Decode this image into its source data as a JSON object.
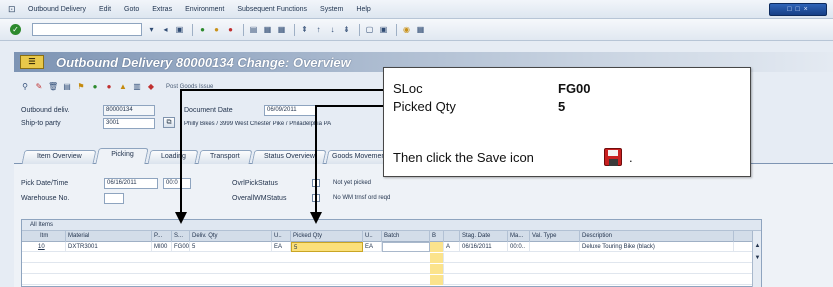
{
  "menu": {
    "items": [
      "Outbound Delivery",
      "Edit",
      "Goto",
      "Extras",
      "Environment",
      "Subsequent Functions",
      "System",
      "Help"
    ]
  },
  "window_controls": {
    "label": "□ □ ×"
  },
  "toolbar": {
    "command_value": ""
  },
  "page": {
    "title": "Outbound Delivery 80000134 Change: Overview",
    "app_icon_label": "☰",
    "post_goods_issue_label": "Post Goods Issue"
  },
  "header": {
    "outbound_delivery_label": "Outbound deliv.",
    "outbound_delivery_value": "80000134",
    "ship_to_label": "Ship-to party",
    "ship_to_value": "3001",
    "document_date_label": "Document Date",
    "document_date_value": "06/09/2011",
    "ship_to_address": "Philly Bikes / 3999 West Chester Pike / Philadelphia PA"
  },
  "tabs": [
    "Item Overview",
    "Picking",
    "Loading",
    "Transport",
    "Status Overview",
    "Goods Movement"
  ],
  "picking": {
    "pick_date_label": "Pick Date/Time",
    "pick_date_value": "06/16/2011",
    "pick_time_value": "00:0",
    "warehouse_label": "Warehouse No.",
    "warehouse_value": "",
    "ovrl_pick_status_label": "OvrlPickStatus",
    "ovrl_pick_status_text": "Not yet picked",
    "overall_wm_status_label": "OverallWMStatus",
    "overall_wm_status_text": "No WM trnsf ord reqd"
  },
  "table": {
    "title": "All Items",
    "columns": [
      "Itm",
      "Material",
      "P...",
      "S...",
      "Deliv. Qty",
      "U..",
      "Picked Qty",
      "U..",
      "Batch",
      "B",
      "",
      "Stag. Date",
      "Ma...",
      "Val. Type",
      "Description"
    ],
    "rows": [
      {
        "item": "10",
        "material": "DXTR3001",
        "plant": "MI00",
        "sloc": "FG00",
        "deliv_qty": "5",
        "deliv_unit": "EA",
        "picked_qty": "5",
        "picked_unit": "EA",
        "batch": "",
        "b": "",
        "a": "A",
        "stag_date": "06/16/2011",
        "ma": "00:0..",
        "val_type": "",
        "description": "Deluxe Touring Bike (black)"
      }
    ]
  },
  "callout": {
    "sloc_label": "SLoc",
    "sloc_value": "FG00",
    "picked_qty_label": "Picked Qty",
    "picked_qty_value": "5",
    "instruction": "Then click the Save icon",
    "instruction_end": "."
  },
  "icons": [
    "sap-icon",
    "enter-icon",
    "save-icon",
    "back-icon",
    "exit-icon",
    "cancel-icon",
    "print-icon",
    "find-icon",
    "help-icon"
  ]
}
